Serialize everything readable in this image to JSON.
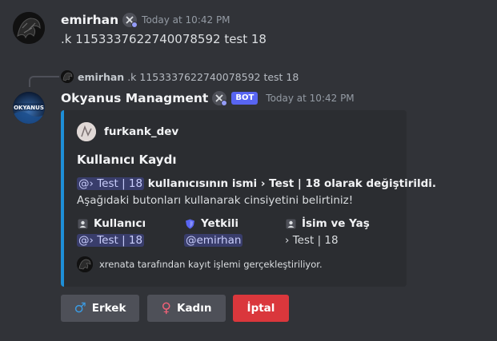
{
  "messages": [
    {
      "author": "emirhan",
      "timestamp": "Today at 10:42 PM",
      "text": ".k 1153337622740078592 test 18"
    }
  ],
  "reply": {
    "reference": {
      "author": "emirhan",
      "text": ".k 1153337622740078592 test 18"
    },
    "author": "Okyanus Managment",
    "bot_tag": "BOT",
    "timestamp": "Today at 10:42 PM",
    "avatar_text": "OKYANUS",
    "embed": {
      "accent_color": "#1e8fd8",
      "author": "furkank_dev",
      "title": "Kullanıcı Kaydı",
      "desc_mention": "@› Test | 18",
      "desc_mid": " kullanıcısının ismi ",
      "desc_bold": "› Test | 18 olarak değiştirildi.",
      "desc_line2": "Aşağıdaki butonları kullanarak cinsiyetini belirtiniz!",
      "fields": [
        {
          "name": "Kullanıcı",
          "value": "@› Test | 18",
          "icon": "user-icon"
        },
        {
          "name": "Yetkili",
          "value": "@emirhan",
          "icon": "shield-icon"
        },
        {
          "name": "İsim ve Yaş",
          "value": "› Test | 18",
          "icon": "id-card-icon"
        }
      ],
      "footer": "xrenata tarafından kayıt işlemi gerçekleştiriliyor."
    },
    "buttons": [
      {
        "label": "Erkek",
        "symbol": "♂",
        "symbol_color": "#3b9ae1",
        "style": "secondary"
      },
      {
        "label": "Kadın",
        "symbol": "♀",
        "symbol_color": "#f26178",
        "style": "secondary"
      },
      {
        "label": "İptal",
        "symbol": "",
        "style": "danger"
      }
    ]
  }
}
